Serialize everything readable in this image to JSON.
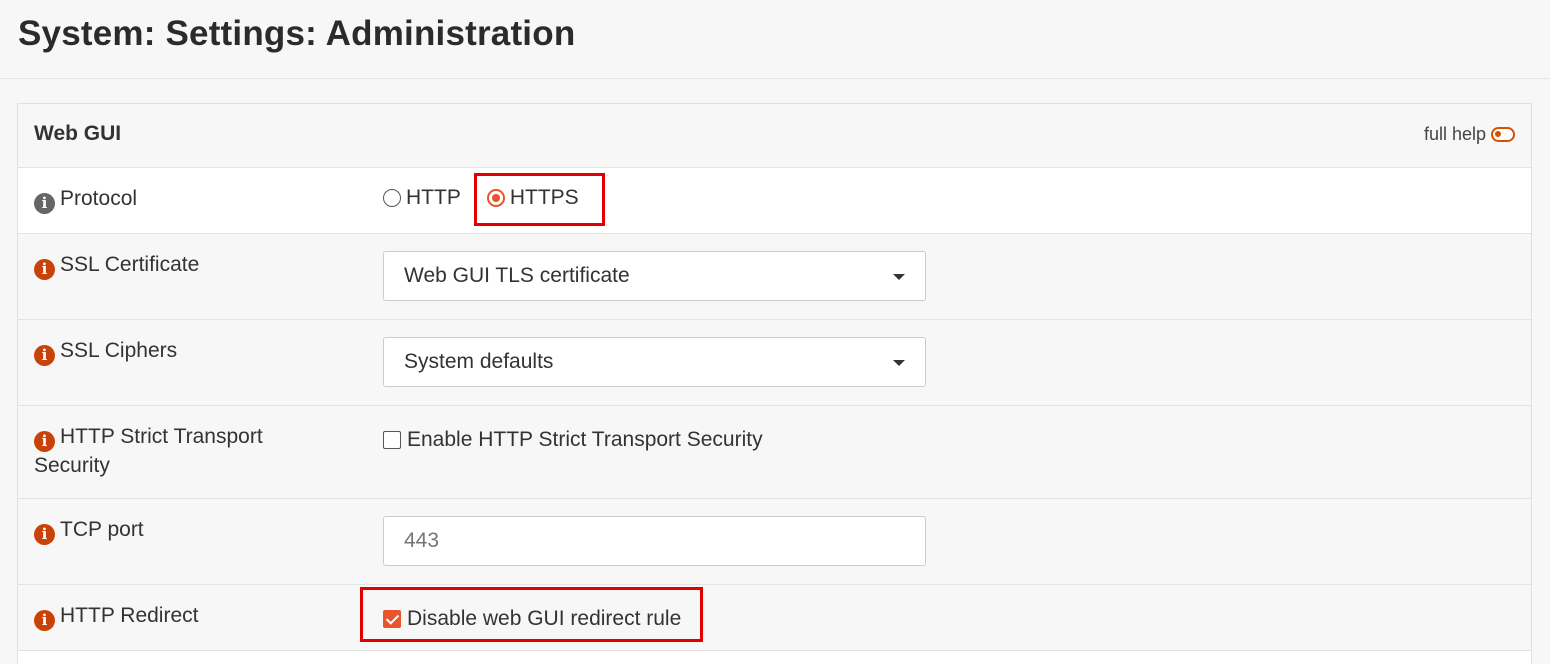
{
  "page": {
    "title": "System: Settings: Administration"
  },
  "section": {
    "title": "Web GUI",
    "full_help_label": "full help"
  },
  "fields": {
    "protocol": {
      "label": "Protocol",
      "options": [
        "HTTP",
        "HTTPS"
      ],
      "selected": "HTTPS"
    },
    "ssl_certificate": {
      "label": "SSL Certificate",
      "value": "Web GUI TLS certificate"
    },
    "ssl_ciphers": {
      "label": "SSL Ciphers",
      "value": "System defaults"
    },
    "hsts": {
      "label": "HTTP Strict Transport Security",
      "checkbox_label": "Enable HTTP Strict Transport Security",
      "checked": false
    },
    "tcp_port": {
      "label": "TCP port",
      "placeholder": "443"
    },
    "http_redirect": {
      "label": "HTTP Redirect",
      "checkbox_label": "Disable web GUI redirect rule",
      "checked": true
    }
  },
  "icons": {
    "info": "i"
  },
  "colors": {
    "accent": "#e8542b",
    "highlight": "#e00000",
    "info_orange": "#c9420a",
    "info_grey": "#666666"
  }
}
